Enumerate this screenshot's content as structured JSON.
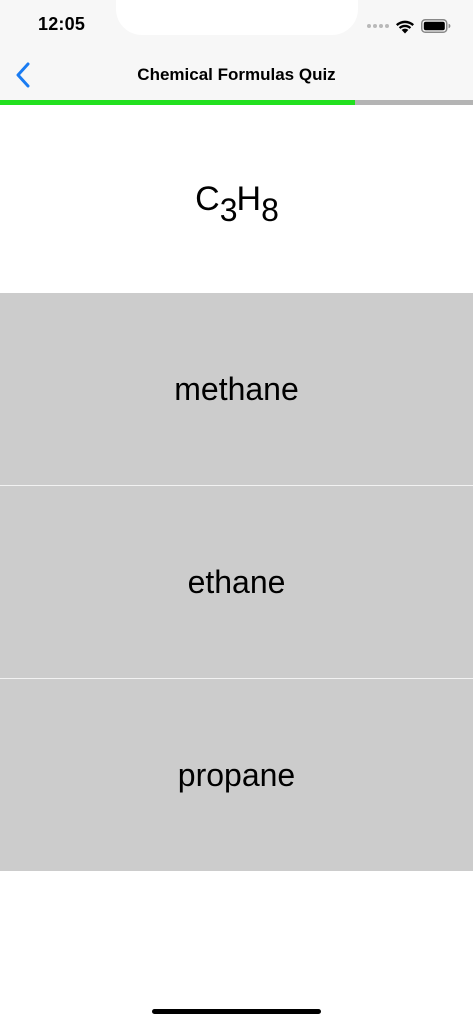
{
  "status_bar": {
    "time": "12:05",
    "icons": [
      "cellular-dots-icon",
      "wifi-icon",
      "battery-icon"
    ]
  },
  "nav": {
    "back_icon": "chevron-left-icon",
    "title": "Chemical Formulas Quiz"
  },
  "progress": {
    "fraction": 0.75,
    "fill_color": "#22e01f",
    "track_color": "#b4b4b4"
  },
  "question": {
    "formula": [
      {
        "text": "C",
        "sub": false
      },
      {
        "text": "3",
        "sub": true
      },
      {
        "text": "H",
        "sub": false
      },
      {
        "text": "8",
        "sub": true
      }
    ]
  },
  "answers": [
    {
      "label": "methane"
    },
    {
      "label": "ethane"
    },
    {
      "label": "propane"
    }
  ],
  "colors": {
    "accent": "#1a7cf2",
    "answer_background": "#cccccc",
    "header_background": "#f7f7f7"
  }
}
